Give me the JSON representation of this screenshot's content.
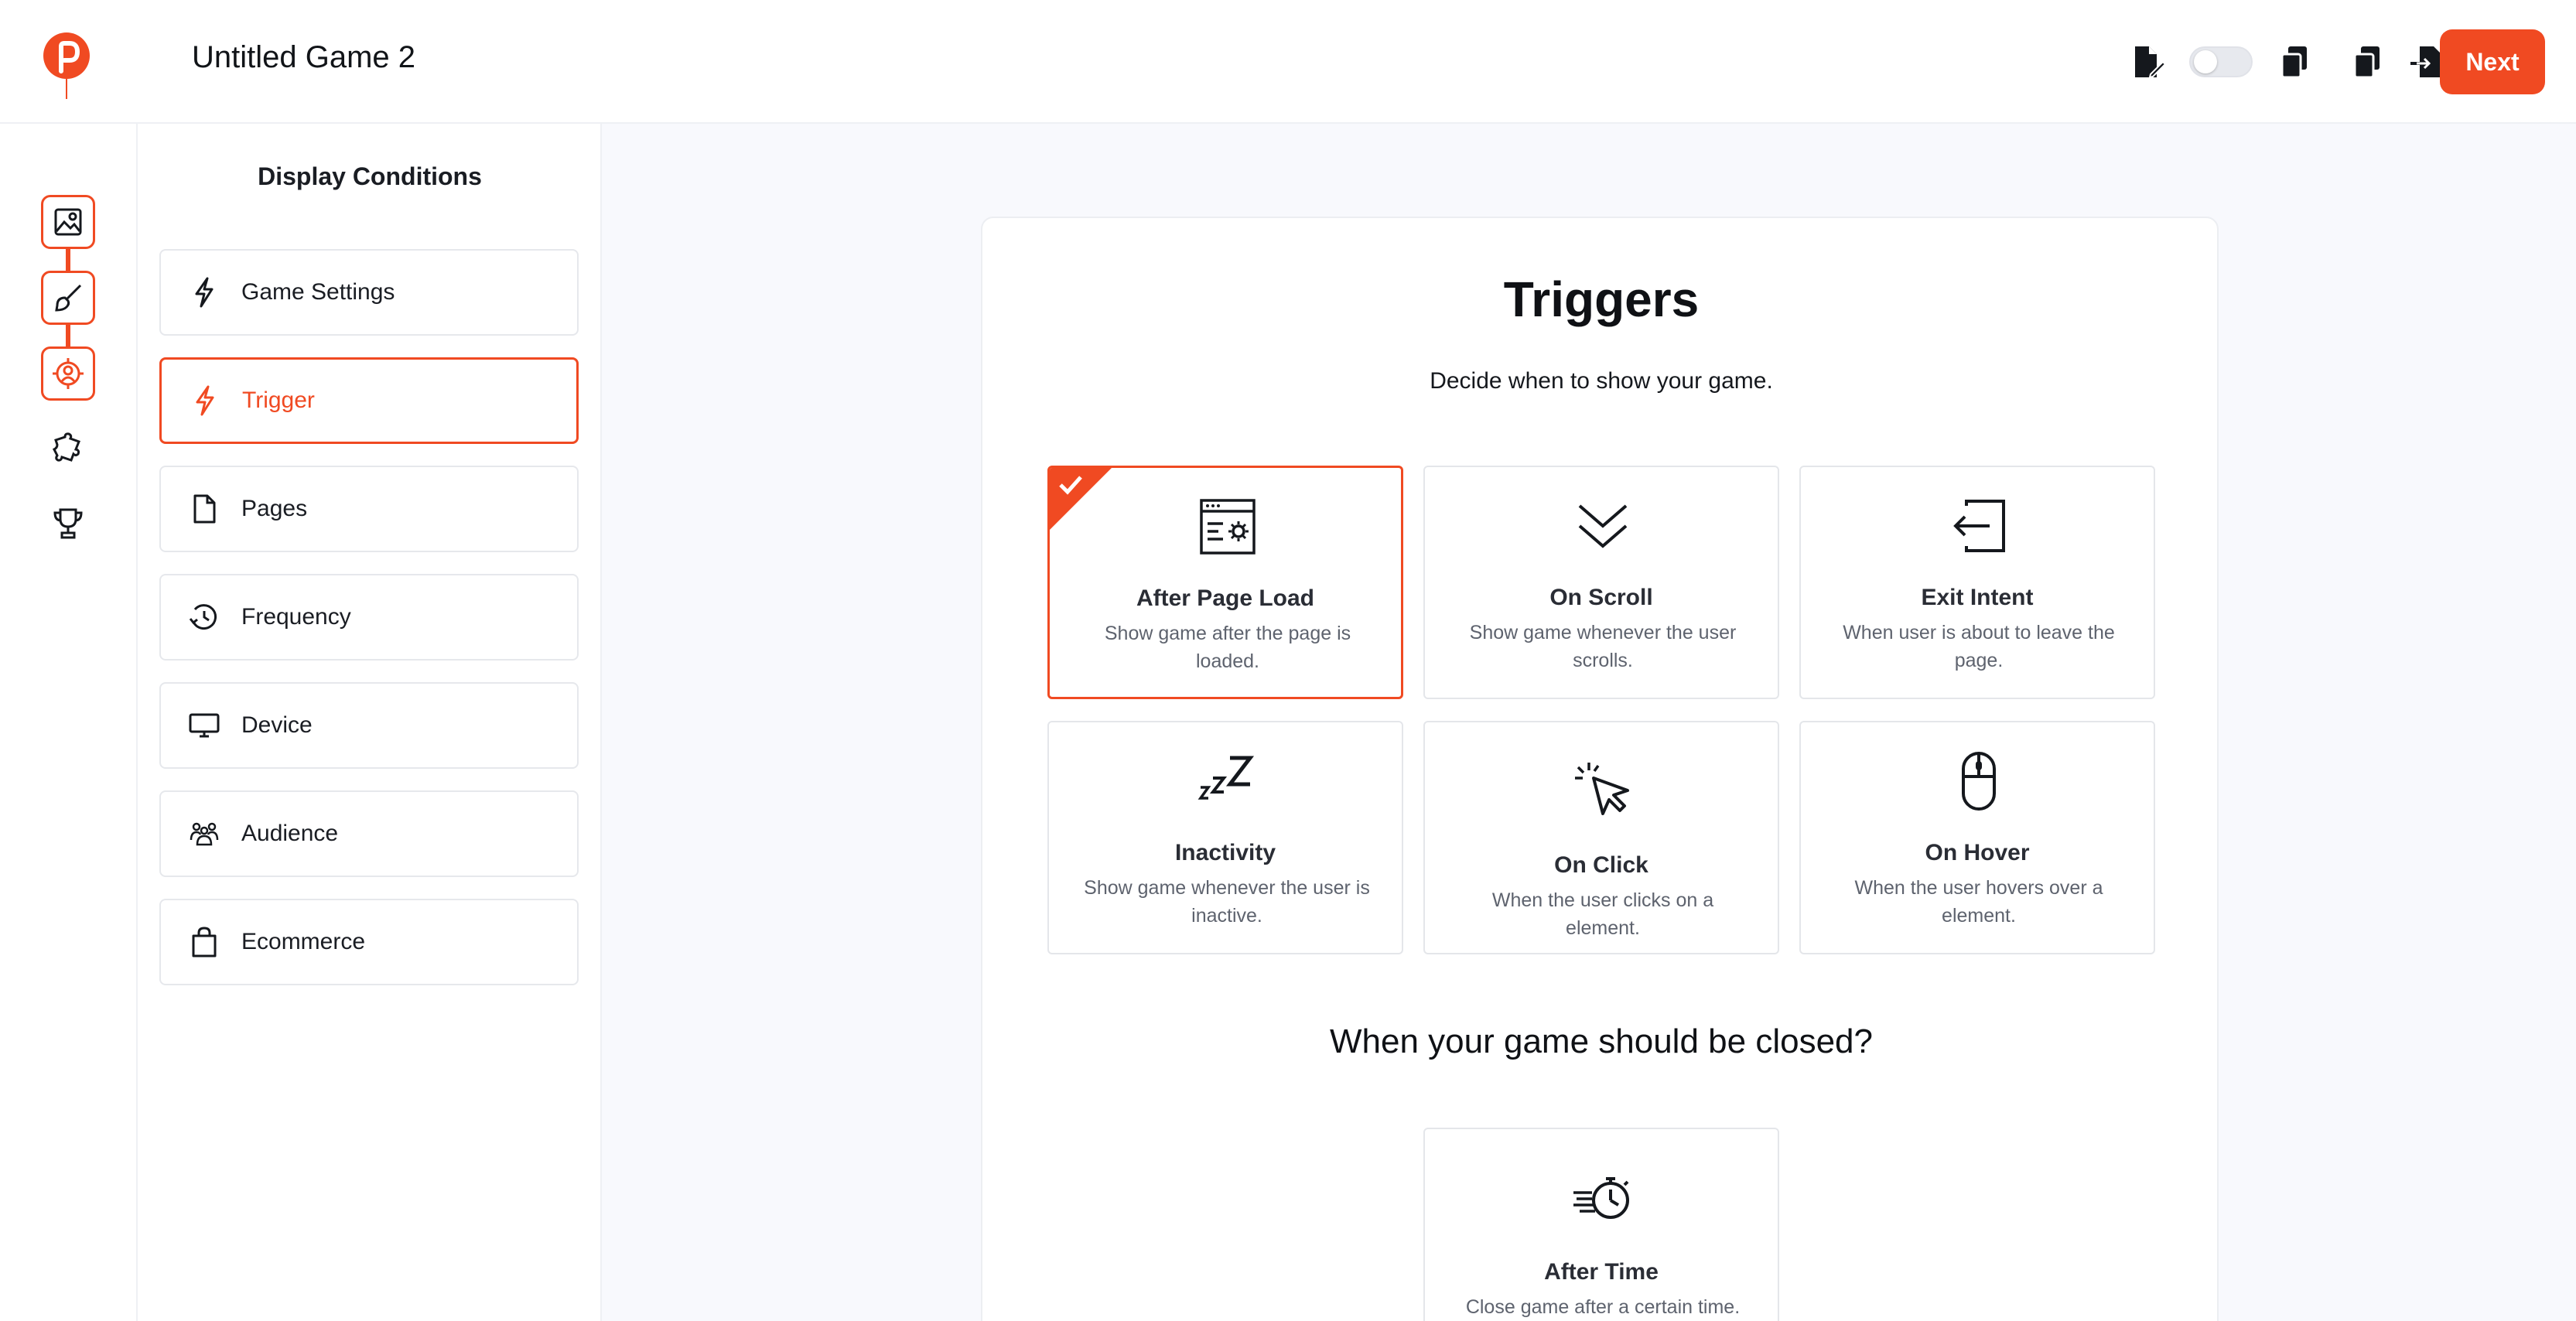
{
  "header": {
    "game_title": "Untitled Game 2",
    "next_label": "Next"
  },
  "panel": {
    "title": "Display Conditions",
    "items": [
      {
        "label": "Game Settings",
        "icon": "lightning-icon",
        "active": false
      },
      {
        "label": "Trigger",
        "icon": "lightning-icon",
        "active": true
      },
      {
        "label": "Pages",
        "icon": "page-icon",
        "active": false
      },
      {
        "label": "Frequency",
        "icon": "frequency-icon",
        "active": false
      },
      {
        "label": "Device",
        "icon": "monitor-icon",
        "active": false
      },
      {
        "label": "Audience",
        "icon": "audience-icon",
        "active": false
      },
      {
        "label": "Ecommerce",
        "icon": "shopping-bag-icon",
        "active": false
      }
    ]
  },
  "main": {
    "title": "Triggers",
    "subtitle": "Decide when to show your game.",
    "options": [
      {
        "title": "After Page Load",
        "desc": "Show game after the page is loaded.",
        "icon": "page-load-icon",
        "selected": true
      },
      {
        "title": "On Scroll",
        "desc": "Show game whenever the user scrolls.",
        "icon": "double-chevron-down-icon",
        "selected": false
      },
      {
        "title": "Exit Intent",
        "desc": "When user is about to leave the page.",
        "icon": "exit-icon",
        "selected": false
      },
      {
        "title": "Inactivity",
        "desc": "Show game whenever the user is inactive.",
        "icon": "sleep-icon",
        "selected": false
      },
      {
        "title": "On Click",
        "desc": "When the user clicks on a element.",
        "icon": "cursor-click-icon",
        "selected": false
      },
      {
        "title": "On Hover",
        "desc": "When the user hovers over a element.",
        "icon": "mouse-icon",
        "selected": false
      }
    ],
    "closed_title": "When your game should be closed?",
    "close_options": [
      {
        "title": "After Time",
        "desc": "Close game after a certain time.",
        "icon": "stopwatch-icon"
      }
    ]
  },
  "colors": {
    "accent": "#f04a22",
    "main_bg": "#f8f9fd",
    "border": "#e4e6ea"
  }
}
